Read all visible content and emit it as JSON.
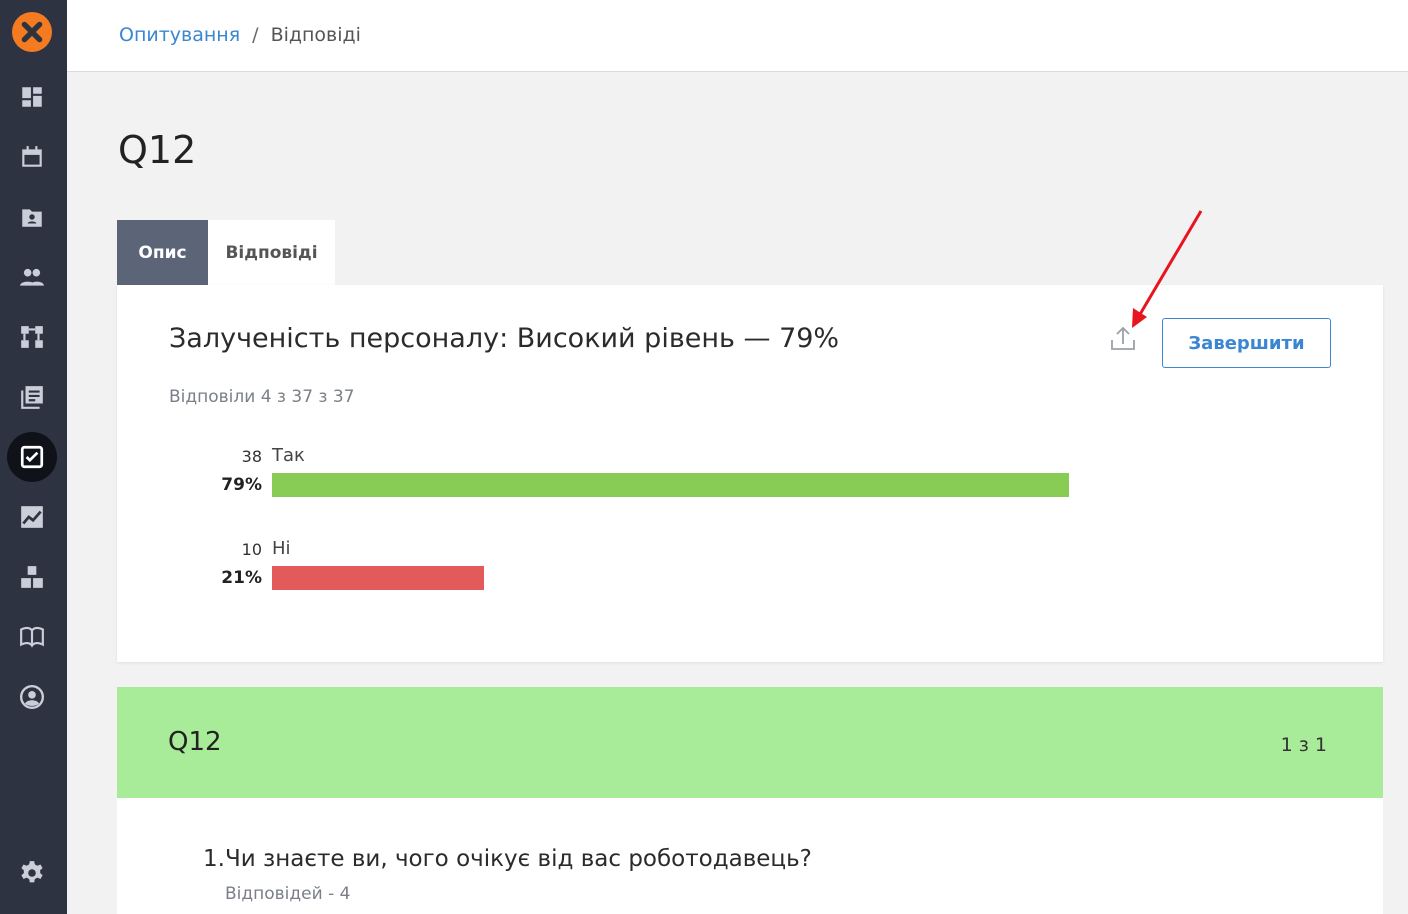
{
  "breadcrumb": {
    "link": "Опитування",
    "separator": "/",
    "current": "Відповіді"
  },
  "page": {
    "title": "Q12"
  },
  "tabs": [
    {
      "label": "Опис",
      "active": true
    },
    {
      "label": "Відповіді",
      "active": false
    }
  ],
  "card": {
    "title": "Залученість персоналу: Високий рівень — 79%",
    "answered": "Відповіли 4 з 37 з 37",
    "finish_label": "Завершити",
    "share_icon": "upload-icon"
  },
  "results": [
    {
      "label": "Так",
      "count": "38",
      "pct_text": "79%",
      "pct": 79,
      "color": "#88cc55"
    },
    {
      "label": "Ні",
      "count": "10",
      "pct_text": "21%",
      "pct": 21,
      "color": "#e35a5a"
    }
  ],
  "banner": {
    "title": "Q12",
    "pager": "1 з 1",
    "color": "#a8eb98"
  },
  "question": {
    "text": "1.Чи знаєте ви, чого очікує від вас роботодавець?",
    "count": "Відповідей - 4"
  },
  "sidebar": {
    "items": [
      "dashboard-icon",
      "calendar-icon",
      "contacts-icon",
      "people-icon",
      "workflow-icon",
      "library-icon",
      "surveys-icon",
      "analytics-icon",
      "modules-icon",
      "knowledge-book-icon",
      "profile-icon",
      "settings-icon"
    ],
    "active": "surveys-icon"
  },
  "colors": {
    "accent": "#3b86d0",
    "sidebar": "#2d3340",
    "logo": "#f47b20",
    "annotation_arrow": "#e8141e"
  }
}
